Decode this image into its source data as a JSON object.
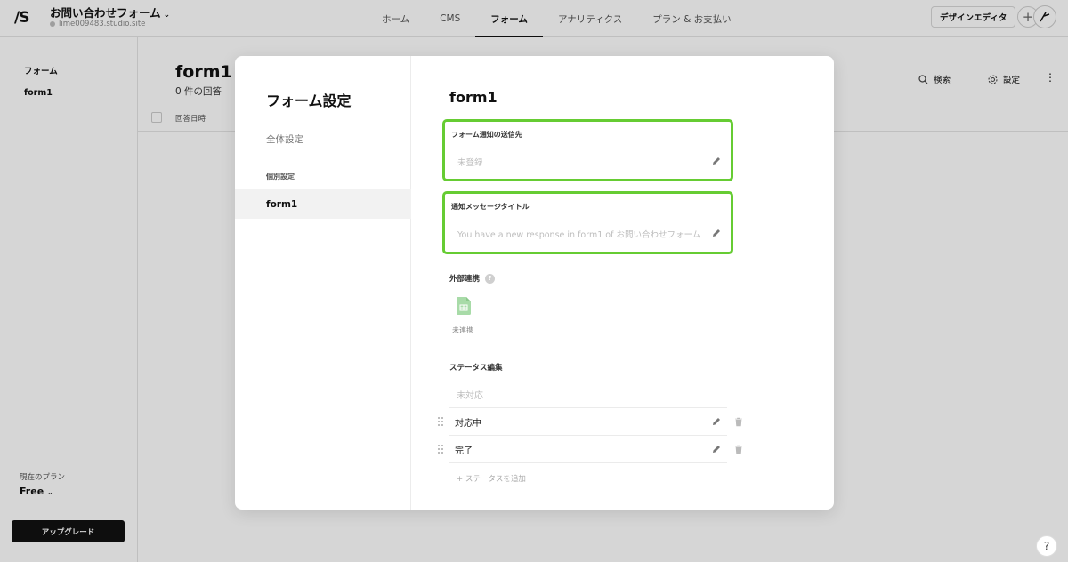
{
  "topbar": {
    "logo": "/S",
    "site_name": "お問い合わせフォーム",
    "site_url": "lime009483.studio.site",
    "nav": [
      "ホーム",
      "CMS",
      "フォーム",
      "アナリティクス",
      "プラン & お支払い"
    ],
    "active_nav": "フォーム",
    "design_editor_label": "デザインエディタ",
    "plus_label": "+"
  },
  "sidebar": {
    "title": "フォーム",
    "item": "form1",
    "plan_label": "現在のプラン",
    "plan_value": "Free",
    "upgrade_label": "アップグレード"
  },
  "main": {
    "title": "form1",
    "count": "0 件の回答",
    "search_label": "検索",
    "settings_label": "設定",
    "column_date": "回答日時"
  },
  "modal": {
    "title": "フォーム設定",
    "general": "全体設定",
    "section_individual": "個別設定",
    "selected_form": "form1",
    "content_title": "form1",
    "notify_label": "フォーム通知の送信先",
    "notify_value": "未登録",
    "message_title_label": "通知メッセージタイトル",
    "message_title_placeholder": "You have a new response in form1 of お問い合わせフォーム",
    "external_label": "外部連携",
    "external_status": "未連携",
    "status_label": "ステータス編集",
    "status_unset": "未対応",
    "statuses": [
      "対応中",
      "完了"
    ],
    "add_status": "+ ステータスを追加"
  },
  "help_label": "?",
  "colors": {
    "highlight": "#66cc33",
    "sheets": "#a8dba8"
  }
}
